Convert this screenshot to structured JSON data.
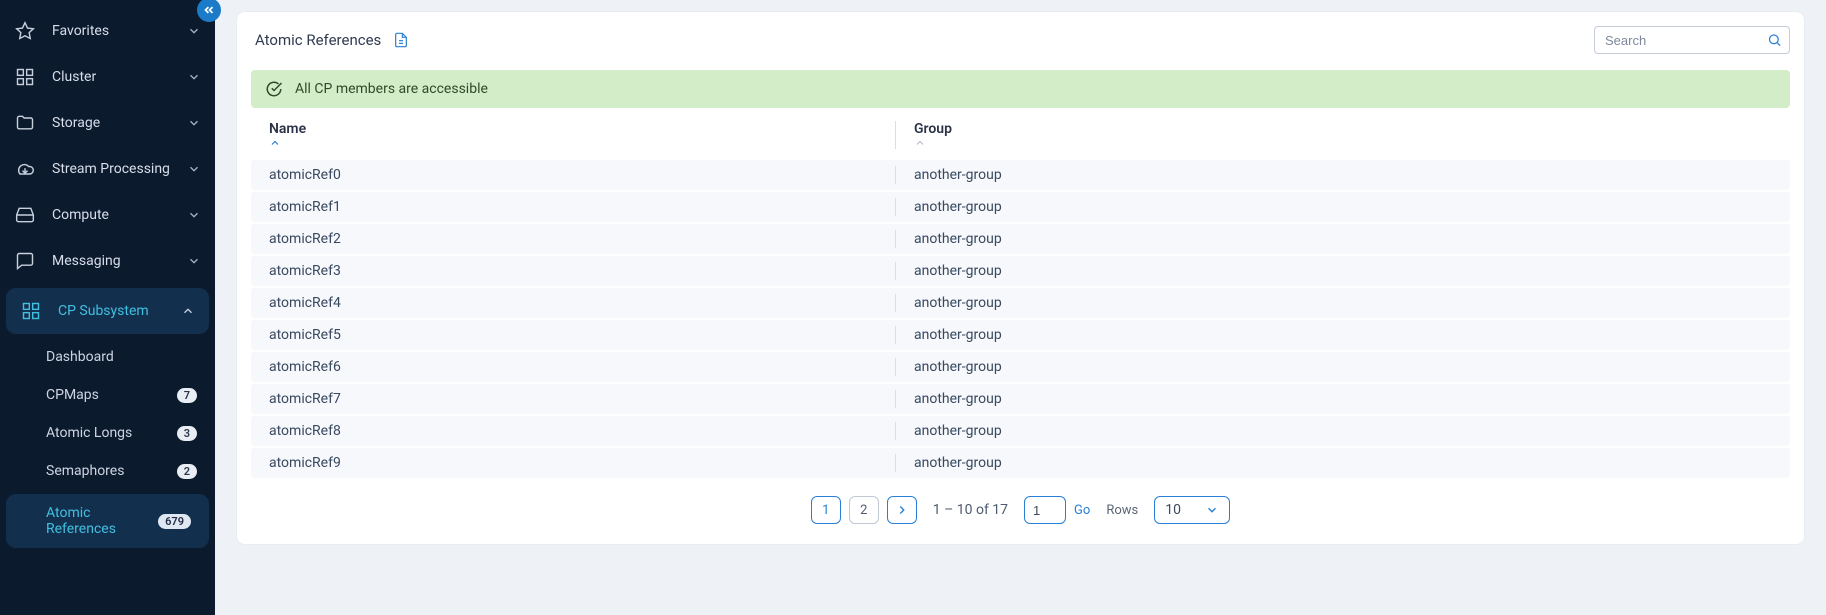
{
  "sidebar": {
    "items": [
      {
        "label": "Favorites"
      },
      {
        "label": "Cluster"
      },
      {
        "label": "Storage"
      },
      {
        "label": "Stream Processing"
      },
      {
        "label": "Compute"
      },
      {
        "label": "Messaging"
      },
      {
        "label": "CP Subsystem"
      }
    ],
    "sub": {
      "dashboard": "Dashboard",
      "cpmaps": {
        "label": "CPMaps",
        "count": "7"
      },
      "atomic_longs": {
        "label": "Atomic Longs",
        "count": "3"
      },
      "semaphores": {
        "label": "Semaphores",
        "count": "2"
      },
      "atomic_references": {
        "label": "Atomic References",
        "count": "679"
      }
    }
  },
  "page": {
    "title": "Atomic References",
    "search_placeholder": "Search",
    "status": "All CP members are accessible"
  },
  "table": {
    "columns": {
      "name": "Name",
      "group": "Group"
    },
    "rows": [
      {
        "name": "atomicRef0",
        "group": "another-group"
      },
      {
        "name": "atomicRef1",
        "group": "another-group"
      },
      {
        "name": "atomicRef2",
        "group": "another-group"
      },
      {
        "name": "atomicRef3",
        "group": "another-group"
      },
      {
        "name": "atomicRef4",
        "group": "another-group"
      },
      {
        "name": "atomicRef5",
        "group": "another-group"
      },
      {
        "name": "atomicRef6",
        "group": "another-group"
      },
      {
        "name": "atomicRef7",
        "group": "another-group"
      },
      {
        "name": "atomicRef8",
        "group": "another-group"
      },
      {
        "name": "atomicRef9",
        "group": "another-group"
      }
    ]
  },
  "pager": {
    "page1": "1",
    "page2": "2",
    "range": "1 – 10 of 17",
    "goto_value": "1",
    "go_label": "Go",
    "rows_label": "Rows",
    "rows_value": "10"
  }
}
